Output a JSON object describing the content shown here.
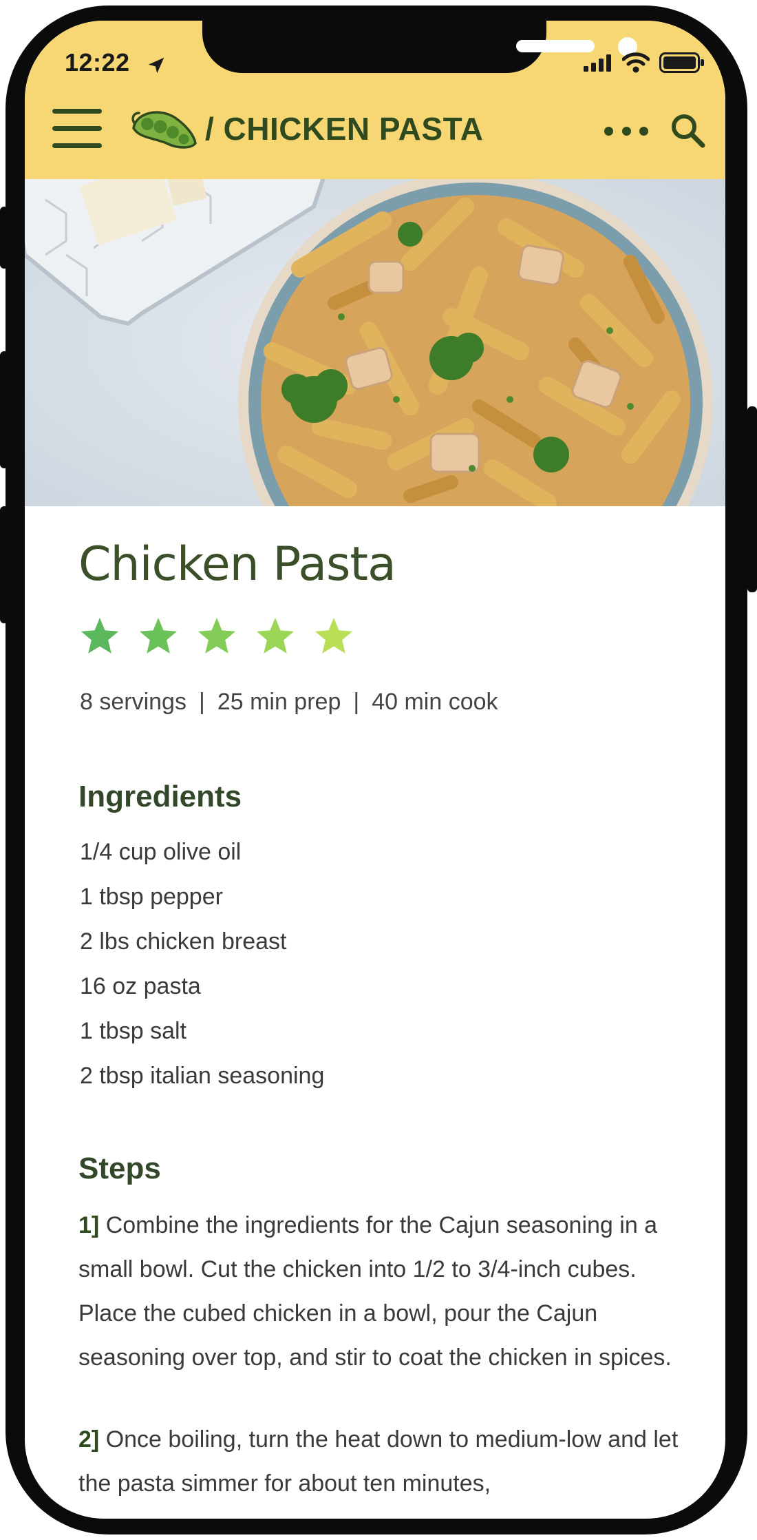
{
  "status_bar": {
    "time": "12:22",
    "icons": [
      "location-arrow-icon",
      "cellular-signal-icon",
      "wifi-icon",
      "battery-icon"
    ]
  },
  "app_bar": {
    "logo": "peas-logo",
    "title": "/ CHICKEN PASTA",
    "left_icon": "menu-icon",
    "right_icons": [
      "more-icon",
      "search-icon"
    ]
  },
  "recipe": {
    "title": "Chicken Pasta",
    "rating": 5,
    "rating_max": 5,
    "servings": "8 servings",
    "prep": "25 min prep",
    "cook": "40 min cook",
    "separator": "|"
  },
  "ingredients": {
    "heading": "Ingredients",
    "items": [
      "1/4 cup olive oil",
      "1 tbsp pepper",
      "2 lbs chicken breast",
      "16 oz pasta",
      "1 tbsp salt",
      "2 tbsp italian seasoning"
    ]
  },
  "steps": {
    "heading": "Steps",
    "items": [
      {
        "number": "1]",
        "text": "Combine the ingredients for the Cajun seasoning in a small bowl. Cut the chicken into 1/2 to 3/4-inch cubes. Place the cubed chicken in a bowl, pour the Cajun seasoning over top, and stir to coat the chicken in spices."
      },
      {
        "number": "2]",
        "text": "Once boiling, turn the heat down to medium-low and let the pasta simmer for about ten minutes,"
      }
    ]
  },
  "colors": {
    "header_bg": "#f7d774",
    "brand_green": "#2f4a1f",
    "star_colors": [
      "#5cb85c",
      "#6cc25a",
      "#84cc58",
      "#9cd657",
      "#b9df57"
    ]
  }
}
